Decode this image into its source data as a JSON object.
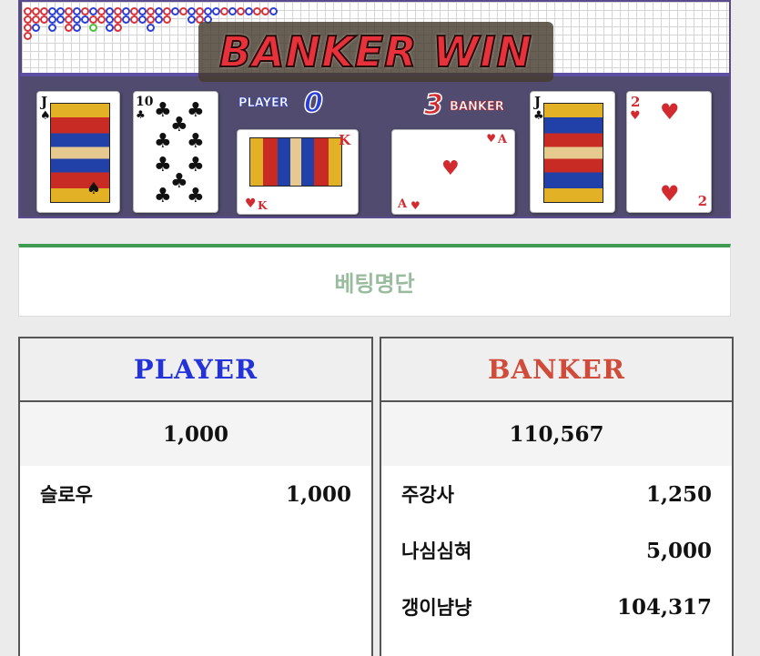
{
  "board": {
    "result_text": "BANKER WIN",
    "player_label": "PLAYER",
    "player_score": "0",
    "banker_label": "BANKER",
    "banker_score": "3",
    "player_cards": [
      {
        "rank": "J",
        "suit": "♠",
        "color": "black"
      },
      {
        "rank": "10",
        "suit": "♣",
        "color": "black"
      },
      {
        "rank": "K",
        "suit": "♥",
        "color": "red"
      }
    ],
    "banker_cards": [
      {
        "rank": "A",
        "suit": "♥",
        "color": "red"
      },
      {
        "rank": "J",
        "suit": "♣",
        "color": "black"
      },
      {
        "rank": "2",
        "suit": "♥",
        "color": "red"
      }
    ]
  },
  "betting": {
    "title": "베팅명단",
    "player": {
      "header": "PLAYER",
      "total": "1,000",
      "bets": [
        {
          "name": "슬로우",
          "amount": "1,000"
        }
      ]
    },
    "banker": {
      "header": "BANKER",
      "total": "110,567",
      "bets": [
        {
          "name": "주강사",
          "amount": "1,250"
        },
        {
          "name": "나심심혀",
          "amount": "5,000"
        },
        {
          "name": "갱이냠냥",
          "amount": "104,317"
        }
      ]
    }
  },
  "colors": {
    "player": "#2433d9",
    "banker": "#d14b3a",
    "accent_green": "#3f9a52"
  }
}
